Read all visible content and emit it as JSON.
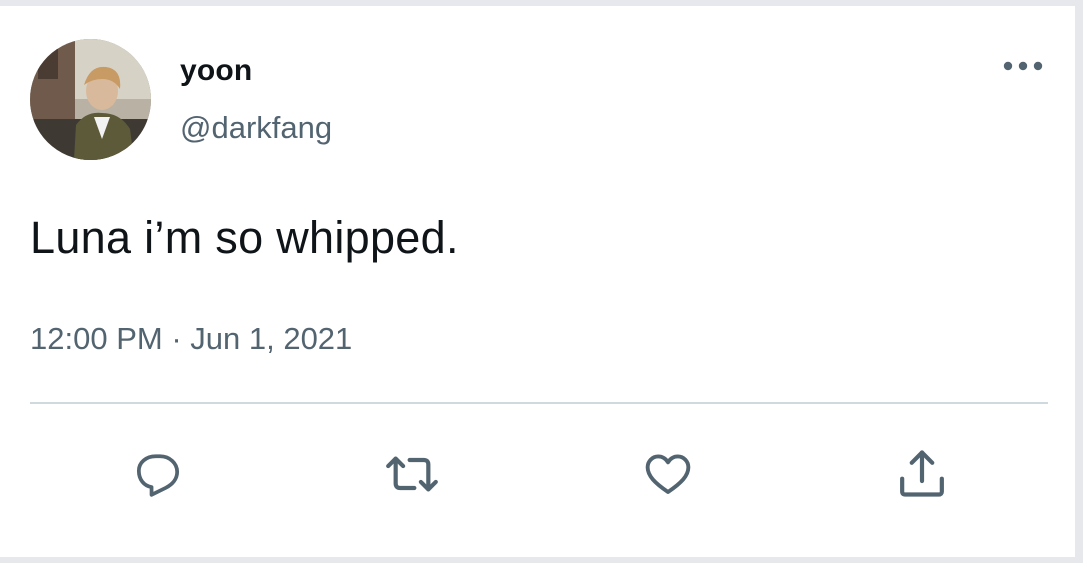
{
  "tweet": {
    "display_name": "yoon",
    "handle": "@darkfang",
    "text": "Luna i’m so whipped.",
    "time": "12:00 PM",
    "separator": " · ",
    "date": "Jun 1, 2021"
  },
  "icons": {
    "more": "more-horizontal-icon",
    "reply": "reply-icon",
    "retweet": "retweet-icon",
    "like": "heart-icon",
    "share": "share-icon"
  },
  "colors": {
    "text_primary": "#0f1419",
    "text_secondary": "#536471",
    "divider": "#cfd9de",
    "icon": "#536471"
  }
}
